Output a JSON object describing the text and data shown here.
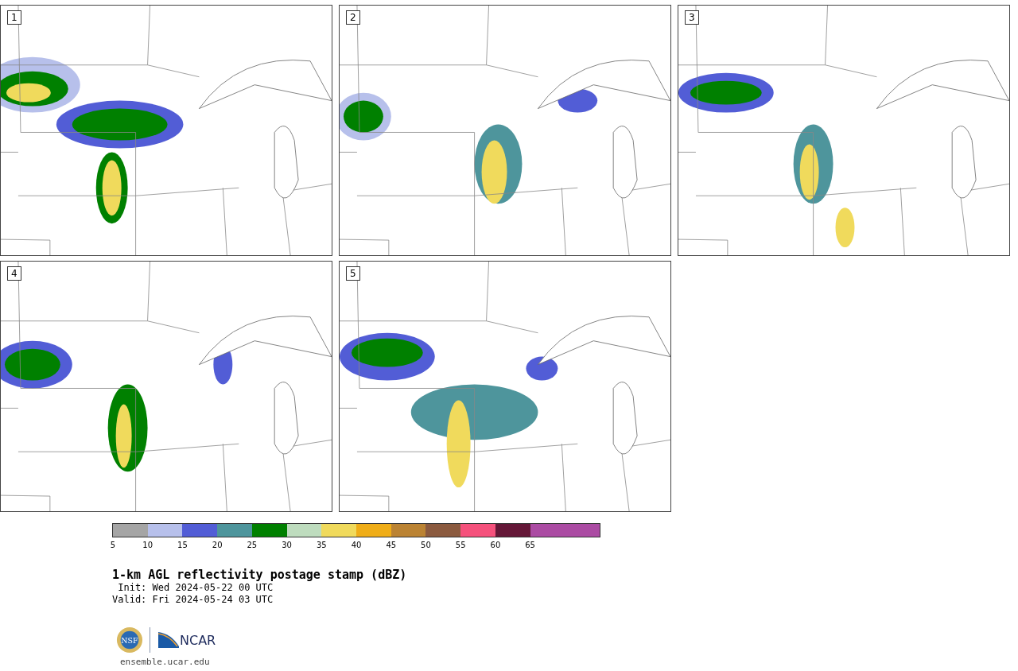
{
  "panels": [
    {
      "label": "1"
    },
    {
      "label": "2"
    },
    {
      "label": "3"
    },
    {
      "label": "4"
    },
    {
      "label": "5"
    }
  ],
  "colorbar": {
    "segments": [
      {
        "color": "#a5a5a5",
        "tick": "5"
      },
      {
        "color": "#b7c0eb",
        "tick": "10"
      },
      {
        "color": "#525dd6",
        "tick": "15"
      },
      {
        "color": "#4e959c",
        "tick": "20"
      },
      {
        "color": "#008000",
        "tick": "25"
      },
      {
        "color": "#bedcbe",
        "tick": "30"
      },
      {
        "color": "#f0da5c",
        "tick": "35"
      },
      {
        "color": "#efad18",
        "tick": "40"
      },
      {
        "color": "#bb8333",
        "tick": "45"
      },
      {
        "color": "#8b5a3f",
        "tick": "50"
      },
      {
        "color": "#f5517c",
        "tick": "55"
      },
      {
        "color": "#641737",
        "tick": "60"
      },
      {
        "color": "#ab4ba3",
        "tick": "65"
      },
      {
        "color": "#ab4ba3"
      }
    ]
  },
  "title": "1-km AGL reflectivity postage stamp (dBZ)",
  "init": " Init: Wed 2024-05-22 00 UTC",
  "valid": "Valid: Fri 2024-05-24 03 UTC",
  "logos": {
    "nsf": "NSF",
    "ncar": "NCAR"
  },
  "footer": "ensemble.ucar.edu"
}
